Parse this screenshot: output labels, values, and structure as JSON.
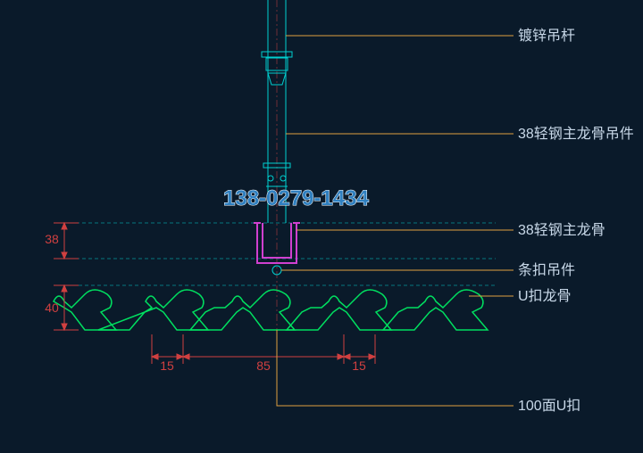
{
  "labels": {
    "rod": "镀锌吊杆",
    "hanger": "38轻钢主龙骨吊件",
    "main": "38轻钢主龙骨",
    "clip": "条扣吊件",
    "ukeel": "U扣龙骨",
    "upanel": "100面U扣"
  },
  "dims": {
    "v38": "38",
    "v40": "40",
    "h15a": "15",
    "h85": "85",
    "h15b": "15"
  },
  "wm": "138-0279-1434"
}
